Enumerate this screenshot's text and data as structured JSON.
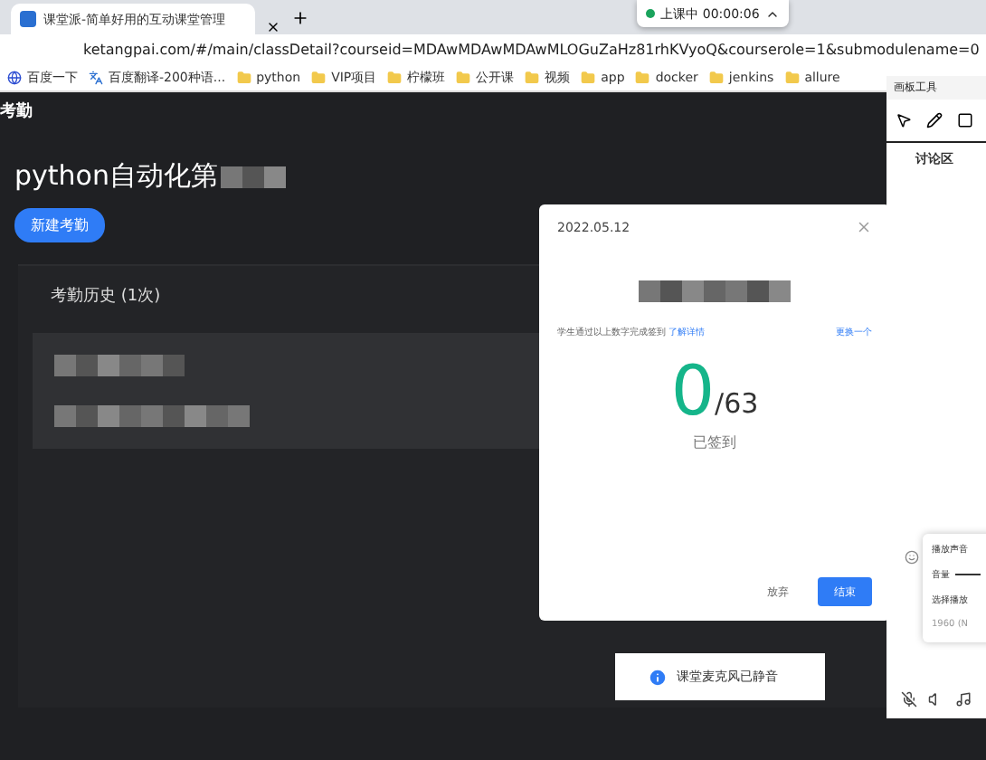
{
  "browser": {
    "tab_title": "课堂派-简单好用的互动课堂管理",
    "url": "ketangpai.com/#/main/classDetail?courseid=MDAwMDAwMDAwMLOGuZaHz81rhKVyoQ&courserole=1&submodulename=0",
    "bookmarks": [
      {
        "label": "百度一下",
        "kind": "site"
      },
      {
        "label": "百度翻译-200种语...",
        "kind": "app"
      },
      {
        "label": "python",
        "kind": "folder"
      },
      {
        "label": "VIP项目",
        "kind": "folder"
      },
      {
        "label": "柠檬班",
        "kind": "folder"
      },
      {
        "label": "公开课",
        "kind": "folder"
      },
      {
        "label": "视频",
        "kind": "folder"
      },
      {
        "label": "app",
        "kind": "folder"
      },
      {
        "label": "docker",
        "kind": "folder"
      },
      {
        "label": "jenkins",
        "kind": "folder"
      },
      {
        "label": "allure",
        "kind": "folder"
      }
    ]
  },
  "class_status": "上课中 00:00:06",
  "page": {
    "section": "考勤",
    "course_title": "python自动化第",
    "new_button": "新建考勤",
    "history_title": "考勤历史 (1次)"
  },
  "modal": {
    "date": "2022.05.12",
    "hint": "学生通过以上数字完成签到",
    "hint_link": "了解详情",
    "refresh": "更换一个",
    "count": "0",
    "total": "/63",
    "count_label": "已签到",
    "cancel": "放弃",
    "confirm": "结束"
  },
  "toast": "课堂麦克风已静音",
  "board": {
    "title": "画板工具",
    "tab": "讨论区",
    "sound_menu": {
      "title": "播放声音",
      "volume": "音量",
      "volume_slider": {
        "level": 1
      },
      "select": "选择播放",
      "device": "1960 (N"
    }
  }
}
